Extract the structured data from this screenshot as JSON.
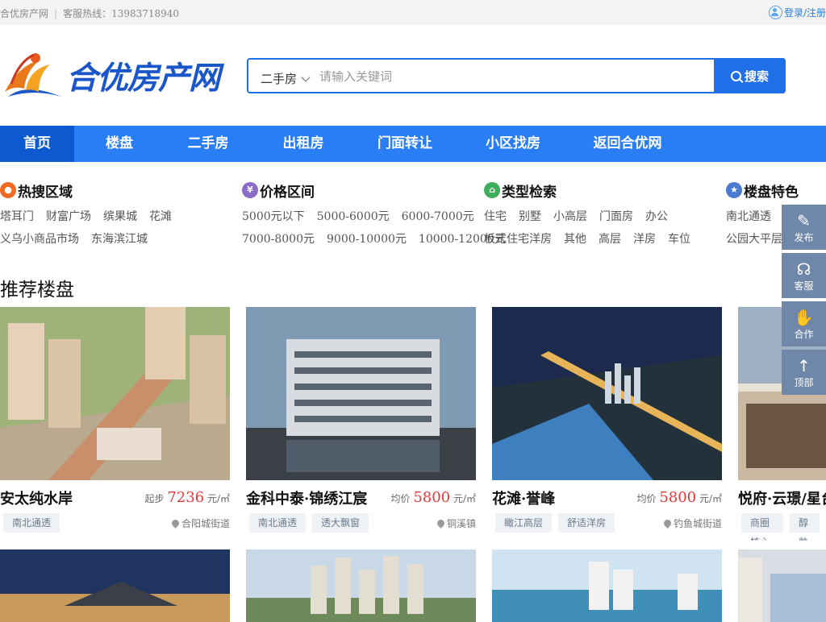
{
  "topbar": {
    "site_name": "合优房产网",
    "separator": "|",
    "hotline": "客服热线：13983718940",
    "login": "登录/注册"
  },
  "logo": {
    "text": "合优房产网"
  },
  "search": {
    "category": "二手房",
    "placeholder": "请输入关键词",
    "button": "搜索"
  },
  "nav": {
    "items": [
      "首页",
      "楼盘",
      "二手房",
      "出租房",
      "门面转让",
      "小区找房",
      "返回合优网"
    ],
    "active": "首页"
  },
  "filters": {
    "area": {
      "title": "热搜区域",
      "row1": [
        "塔耳门",
        "财富广场",
        "缤果城",
        "花滩"
      ],
      "row2": [
        "义乌小商品市场",
        "东海滨江城"
      ]
    },
    "price": {
      "title": "价格区间",
      "row1": [
        "5000元以下",
        "5000-6000元",
        "6000-7000元"
      ],
      "row2": [
        "7000-8000元",
        "9000-10000元",
        "10000-12000元"
      ]
    },
    "type": {
      "title": "类型检索",
      "row1": [
        "住宅",
        "别墅",
        "小高层",
        "门面房",
        "办公"
      ],
      "row2": [
        "板式住宅洋房",
        "其他",
        "高层",
        "洋房",
        "车位"
      ]
    },
    "feature": {
      "title": "楼盘特色",
      "row1": [
        "南北通透"
      ],
      "row2": [
        "公园大平层"
      ]
    }
  },
  "recommend": {
    "title": "推荐楼盘",
    "cards": [
      {
        "name": "安太纯水岸",
        "price_prefix": "起步",
        "price": "7236",
        "unit": "元/㎡",
        "tags": [
          "南北通透"
        ],
        "location": "合阳城街道"
      },
      {
        "name": "金科中泰·锦绣江宸",
        "price_prefix": "均价",
        "price": "5800",
        "unit": "元/㎡",
        "tags": [
          "南北通透",
          "透大飘窗"
        ],
        "location": "铜溪镇"
      },
      {
        "name": "花滩·誉峰",
        "price_prefix": "均价",
        "price": "5800",
        "unit": "元/㎡",
        "tags": [
          "瞰江高层",
          "舒适洋房"
        ],
        "location": "钓鱼城街道"
      },
      {
        "name": "悦府·云璟/星台",
        "price_prefix": "",
        "price": "",
        "unit": "",
        "tags": [
          "商圈核心",
          "醇熟"
        ],
        "location": ""
      }
    ]
  },
  "side_tools": [
    {
      "label": "发布",
      "icon": "edit-icon"
    },
    {
      "label": "客服",
      "icon": "headset-icon"
    },
    {
      "label": "合作",
      "icon": "handshake-icon"
    },
    {
      "label": "顶部",
      "icon": "arrow-up-icon"
    }
  ],
  "colors": {
    "primary": "#2a7ef5",
    "nav_active": "#0d5ad0",
    "price": "#e23a3a",
    "side": "#6f87a8"
  }
}
